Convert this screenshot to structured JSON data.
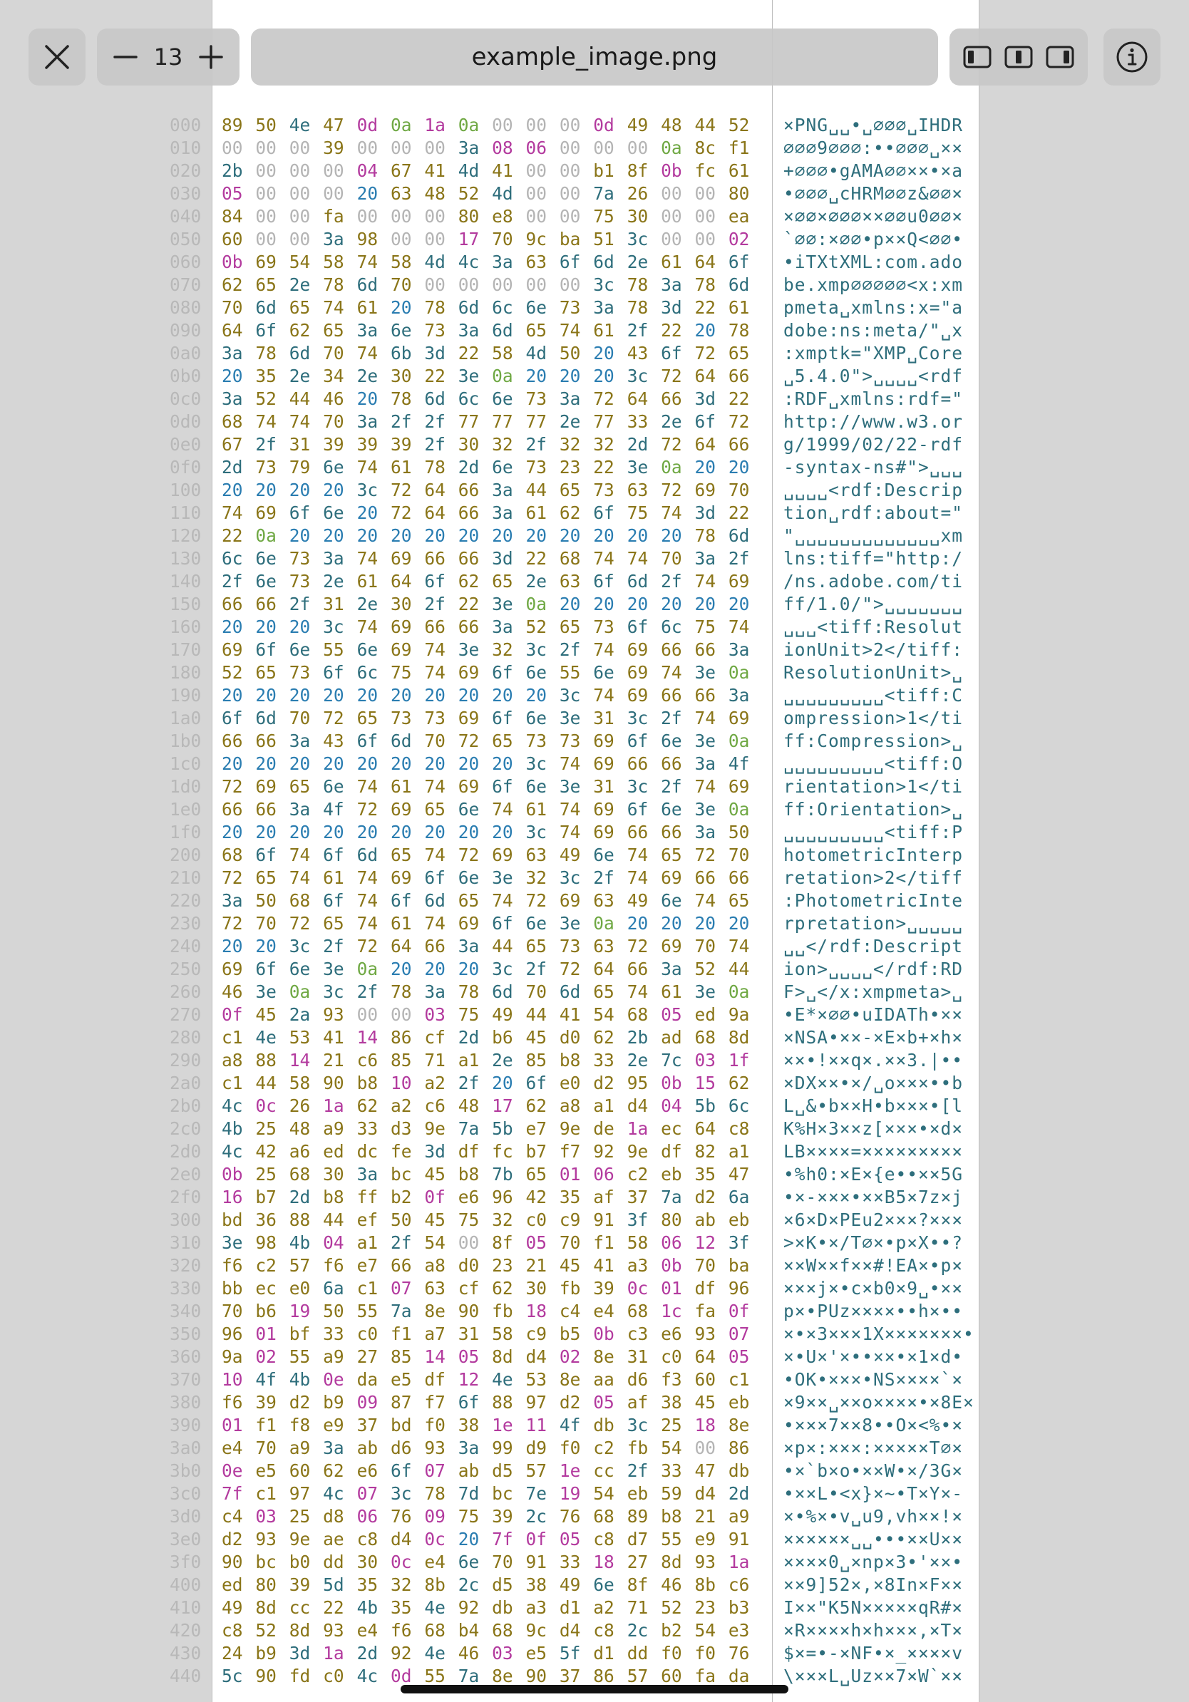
{
  "toolbar": {
    "close_icon": "close-icon",
    "zoom_level": "13",
    "file_name": "example_image.png",
    "layout_icons": [
      "layout-left-icon",
      "layout-center-icon",
      "layout-right-icon"
    ],
    "info_icon": "info-icon"
  },
  "colors": {
    "hex_text": "#8a7518",
    "hex_letters": "#2e6e7c",
    "null_bytes": "#b4b4b4",
    "space_bytes": "#2a7db1",
    "newline_bytes": "#6fa843",
    "control_bytes": "#b33a9e"
  },
  "rows": [
    {
      "offset": "000",
      "hex": "89 50 4e 47 0d 0a 1a 0a 00 00 00 0d 49 48 44 52",
      "ascii": "×PNG␣␣•␣∅∅∅␣IHDR"
    },
    {
      "offset": "010",
      "hex": "00 00 00 39 00 00 00 3a 08 06 00 00 00 0a 8c f1",
      "ascii": "∅∅∅9∅∅∅:••∅∅∅␣××"
    },
    {
      "offset": "020",
      "hex": "2b 00 00 00 04 67 41 4d 41 00 00 b1 8f 0b fc 61",
      "ascii": "+∅∅∅•gAMA∅∅××•×a"
    },
    {
      "offset": "030",
      "hex": "05 00 00 00 20 63 48 52 4d 00 00 7a 26 00 00 80",
      "ascii": "•∅∅∅␣cHRM∅∅z&∅∅×"
    },
    {
      "offset": "040",
      "hex": "84 00 00 fa 00 00 00 80 e8 00 00 75 30 00 00 ea",
      "ascii": "×∅∅×∅∅∅××∅∅u0∅∅×"
    },
    {
      "offset": "050",
      "hex": "60 00 00 3a 98 00 00 17 70 9c ba 51 3c 00 00 02",
      "ascii": "`∅∅:×∅∅•p××Q<∅∅•"
    },
    {
      "offset": "060",
      "hex": "0b 69 54 58 74 58 4d 4c 3a 63 6f 6d 2e 61 64 6f",
      "ascii": "•iTXtXML:com.ado"
    },
    {
      "offset": "070",
      "hex": "62 65 2e 78 6d 70 00 00 00 00 00 3c 78 3a 78 6d",
      "ascii": "be.xmp∅∅∅∅∅<x:xm"
    },
    {
      "offset": "080",
      "hex": "70 6d 65 74 61 20 78 6d 6c 6e 73 3a 78 3d 22 61",
      "ascii": "pmeta␣xmlns:x=\"a"
    },
    {
      "offset": "090",
      "hex": "64 6f 62 65 3a 6e 73 3a 6d 65 74 61 2f 22 20 78",
      "ascii": "dobe:ns:meta/\"␣x"
    },
    {
      "offset": "0a0",
      "hex": "3a 78 6d 70 74 6b 3d 22 58 4d 50 20 43 6f 72 65",
      "ascii": ":xmptk=\"XMP␣Core"
    },
    {
      "offset": "0b0",
      "hex": "20 35 2e 34 2e 30 22 3e 0a 20 20 20 3c 72 64 66",
      "ascii": "␣5.4.0\">␣␣␣␣<rdf"
    },
    {
      "offset": "0c0",
      "hex": "3a 52 44 46 20 78 6d 6c 6e 73 3a 72 64 66 3d 22",
      "ascii": ":RDF␣xmlns:rdf=\""
    },
    {
      "offset": "0d0",
      "hex": "68 74 74 70 3a 2f 2f 77 77 77 2e 77 33 2e 6f 72",
      "ascii": "http://www.w3.or"
    },
    {
      "offset": "0e0",
      "hex": "67 2f 31 39 39 39 2f 30 32 2f 32 32 2d 72 64 66",
      "ascii": "g/1999/02/22-rdf"
    },
    {
      "offset": "0f0",
      "hex": "2d 73 79 6e 74 61 78 2d 6e 73 23 22 3e 0a 20 20",
      "ascii": "-syntax-ns#\">␣␣␣"
    },
    {
      "offset": "100",
      "hex": "20 20 20 20 3c 72 64 66 3a 44 65 73 63 72 69 70",
      "ascii": "␣␣␣␣<rdf:Descrip"
    },
    {
      "offset": "110",
      "hex": "74 69 6f 6e 20 72 64 66 3a 61 62 6f 75 74 3d 22",
      "ascii": "tion␣rdf:about=\""
    },
    {
      "offset": "120",
      "hex": "22 0a 20 20 20 20 20 20 20 20 20 20 20 20 78 6d",
      "ascii": "\"␣␣␣␣␣␣␣␣␣␣␣␣␣xm"
    },
    {
      "offset": "130",
      "hex": "6c 6e 73 3a 74 69 66 66 3d 22 68 74 74 70 3a 2f",
      "ascii": "lns:tiff=\"http:/"
    },
    {
      "offset": "140",
      "hex": "2f 6e 73 2e 61 64 6f 62 65 2e 63 6f 6d 2f 74 69",
      "ascii": "/ns.adobe.com/ti"
    },
    {
      "offset": "150",
      "hex": "66 66 2f 31 2e 30 2f 22 3e 0a 20 20 20 20 20 20",
      "ascii": "ff/1.0/\">␣␣␣␣␣␣␣"
    },
    {
      "offset": "160",
      "hex": "20 20 20 3c 74 69 66 66 3a 52 65 73 6f 6c 75 74",
      "ascii": "␣␣␣<tiff:Resolut"
    },
    {
      "offset": "170",
      "hex": "69 6f 6e 55 6e 69 74 3e 32 3c 2f 74 69 66 66 3a",
      "ascii": "ionUnit>2</tiff:"
    },
    {
      "offset": "180",
      "hex": "52 65 73 6f 6c 75 74 69 6f 6e 55 6e 69 74 3e 0a",
      "ascii": "ResolutionUnit>␣"
    },
    {
      "offset": "190",
      "hex": "20 20 20 20 20 20 20 20 20 20 3c 74 69 66 66 3a 43",
      "ascii": "␣␣␣␣␣␣␣␣␣<tiff:C"
    },
    {
      "offset": "1a0",
      "hex": "6f 6d 70 72 65 73 73 69 6f 6e 3e 31 3c 2f 74 69",
      "ascii": "ompression>1</ti"
    },
    {
      "offset": "1b0",
      "hex": "66 66 3a 43 6f 6d 70 72 65 73 73 69 6f 6e 3e 0a",
      "ascii": "ff:Compression>␣"
    },
    {
      "offset": "1c0",
      "hex": "20 20 20 20 20 20 20 20 20 3c 74 69 66 66 3a 4f",
      "ascii": "␣␣␣␣␣␣␣␣␣<tiff:O"
    },
    {
      "offset": "1d0",
      "hex": "72 69 65 6e 74 61 74 69 6f 6e 3e 31 3c 2f 74 69",
      "ascii": "rientation>1</ti"
    },
    {
      "offset": "1e0",
      "hex": "66 66 3a 4f 72 69 65 6e 74 61 74 69 6f 6e 3e 0a",
      "ascii": "ff:Orientation>␣"
    },
    {
      "offset": "1f0",
      "hex": "20 20 20 20 20 20 20 20 20 3c 74 69 66 66 3a 50",
      "ascii": "␣␣␣␣␣␣␣␣␣<tiff:P"
    },
    {
      "offset": "200",
      "hex": "68 6f 74 6f 6d 65 74 72 69 63 49 6e 74 65 72 70",
      "ascii": "hotometricInterp"
    },
    {
      "offset": "210",
      "hex": "72 65 74 61 74 69 6f 6e 3e 32 3c 2f 74 69 66 66",
      "ascii": "retation>2</tiff"
    },
    {
      "offset": "220",
      "hex": "3a 50 68 6f 74 6f 6d 65 74 72 69 63 49 6e 74 65",
      "ascii": ":PhotometricInte"
    },
    {
      "offset": "230",
      "hex": "72 70 72 65 74 61 74 69 6f 6e 3e 0a 20 20 20 20",
      "ascii": "rpretation>␣␣␣␣␣"
    },
    {
      "offset": "240",
      "hex": "20 20 3c 2f 72 64 66 3a 44 65 73 63 72 69 70 74",
      "ascii": "␣␣</rdf:Descript"
    },
    {
      "offset": "250",
      "hex": "69 6f 6e 3e 0a 20 20 20 3c 2f 72 64 66 3a 52 44",
      "ascii": "ion>␣␣␣␣</rdf:RD"
    },
    {
      "offset": "260",
      "hex": "46 3e 0a 3c 2f 78 3a 78 6d 70 6d 65 74 61 3e 0a",
      "ascii": "F>␣</x:xmpmeta>␣"
    },
    {
      "offset": "270",
      "hex": "0f 45 2a 93 00 00 03 75 49 44 41 54 68 05 ed 9a",
      "ascii": "•E*×∅∅•uIDATh•××"
    },
    {
      "offset": "280",
      "hex": "c1 4e 53 41 14 86 cf 2d b6 45 d0 62 2b ad 68 8d",
      "ascii": "×NSA•××-×E×b+×h×"
    },
    {
      "offset": "290",
      "hex": "a8 88 14 21 c6 85 71 a1 2e 85 b8 33 2e 7c 03 1f",
      "ascii": "××•!××q×.××3.|••"
    },
    {
      "offset": "2a0",
      "hex": "c1 44 58 90 b8 10 a2 2f 20 6f e0 d2 95 0b 15 62",
      "ascii": "×DX××•×/␣o×××••b"
    },
    {
      "offset": "2b0",
      "hex": "4c 0c 26 1a 62 a2 c6 48 17 62 a8 a1 d4 04 5b 6c",
      "ascii": "L␣&•b××H•b×××•[l"
    },
    {
      "offset": "2c0",
      "hex": "4b 25 48 a9 33 d3 9e 7a 5b e7 9e de 1a ec 64 c8",
      "ascii": "K%H×3××z[×××•×d×"
    },
    {
      "offset": "2d0",
      "hex": "4c 42 a6 ed dc fe 3d df fc b7 f7 92 9e df 82 a1",
      "ascii": "LB××××=×××××××××"
    },
    {
      "offset": "2e0",
      "hex": "0b 25 68 30 3a bc 45 b8 7b 65 01 06 c2 eb 35 47",
      "ascii": "•%h0:×E×{e••××5G"
    },
    {
      "offset": "2f0",
      "hex": "16 b7 2d b8 ff b2 0f e6 96 42 35 af 37 7a d2 6a",
      "ascii": "•×-×××•××B5×7z×j"
    },
    {
      "offset": "300",
      "hex": "bd 36 88 44 ef 50 45 75 32 c0 c9 91 3f 80 ab eb",
      "ascii": "×6×D×PEu2×××?×××"
    },
    {
      "offset": "310",
      "hex": "3e 98 4b 04 a1 2f 54 00 8f 05 70 f1 58 06 12 3f",
      "ascii": ">×K•×/T∅×•p×X••?"
    },
    {
      "offset": "320",
      "hex": "f6 c2 57 f6 e7 66 a8 d0 23 21 45 41 a3 0b 70 ba",
      "ascii": "××W××f××#!EA×•p×"
    },
    {
      "offset": "330",
      "hex": "bb ec e0 6a c1 07 63 cf 62 30 fb 39 0c 01 df 96",
      "ascii": "×××j×•c×b0×9␣•××"
    },
    {
      "offset": "340",
      "hex": "70 b6 19 50 55 7a 8e 90 fb 18 c4 e4 68 1c fa 0f",
      "ascii": "p×•PUz××××••h×••"
    },
    {
      "offset": "350",
      "hex": "96 01 bf 33 c0 f1 a7 31 58 c9 b5 0b c3 e6 93 07",
      "ascii": "×•×3×××1X×××××××•"
    },
    {
      "offset": "360",
      "hex": "9a 02 55 a9 27 85 14 05 8d d4 02 8e 31 c0 64 05",
      "ascii": "×•U×'×••××•×1×d•"
    },
    {
      "offset": "370",
      "hex": "10 4f 4b 0e da e5 df 12 4e 53 8e aa d6 f3 60 c1",
      "ascii": "•OK•×××•NS××××`×"
    },
    {
      "offset": "380",
      "hex": "f6 39 d2 b9 09 87 f7 6f 88 97 d2 05 af 38 45 eb",
      "ascii": "×9××␣××o××××•×8E×"
    },
    {
      "offset": "390",
      "hex": "01 f1 f8 e9 37 bd f0 38 1e 11 4f db 3c 25 18 8e",
      "ascii": "•×××7××8••O×<%•×"
    },
    {
      "offset": "3a0",
      "hex": "e4 70 a9 3a ab d6 93 3a 99 d9 f0 c2 fb 54 00 86",
      "ascii": "×p×:×××:×××××T∅×"
    },
    {
      "offset": "3b0",
      "hex": "0e e5 60 62 e6 6f 07 ab d5 57 1e cc 2f 33 47 db",
      "ascii": "•×`b×o•××W•×/3G×"
    },
    {
      "offset": "3c0",
      "hex": "7f c1 97 4c 07 3c 78 7d bc 7e 19 54 eb 59 d4 2d",
      "ascii": "•××L•<x}×~•T×Y×-"
    },
    {
      "offset": "3d0",
      "hex": "c4 03 25 d8 06 76 09 75 39 2c 76 68 89 b8 21 a9",
      "ascii": "×•%×•v␣u9,vh××!×"
    },
    {
      "offset": "3e0",
      "hex": "d2 93 9e ae c8 d4 0c 20 7f 0f 05 c8 d7 55 e9 91",
      "ascii": "××××××␣␣•••××U××"
    },
    {
      "offset": "3f0",
      "hex": "90 bc b0 dd 30 0c e4 6e 70 91 33 18 27 8d 93 1a",
      "ascii": "××××0␣×np×3•'××•"
    },
    {
      "offset": "400",
      "hex": "ed 80 39 5d 35 32 8b 2c d5 38 49 6e 8f 46 8b c6",
      "ascii": "××9]52×,×8In×F××"
    },
    {
      "offset": "410",
      "hex": "49 8d cc 22 4b 35 4e 92 db a3 d1 a2 71 52 23 b3",
      "ascii": "I××\"K5N×××××qR#×"
    },
    {
      "offset": "420",
      "hex": "c8 52 8d 93 e4 f6 68 b4 68 9c d4 c8 2c b2 54 e3",
      "ascii": "×R××××h×h×××,×T×"
    },
    {
      "offset": "430",
      "hex": "24 b9 3d 1a 2d 92 4e 46 03 e5 5f d1 dd f0 f0 76",
      "ascii": "$×=•-×NF•×_××××v"
    },
    {
      "offset": "440",
      "hex": "5c 90 fd c0 4c 0d 55 7a 8e 90 37 86 57 60 fa da",
      "ascii": "\\×××L␣Uz××7×W`××"
    }
  ]
}
